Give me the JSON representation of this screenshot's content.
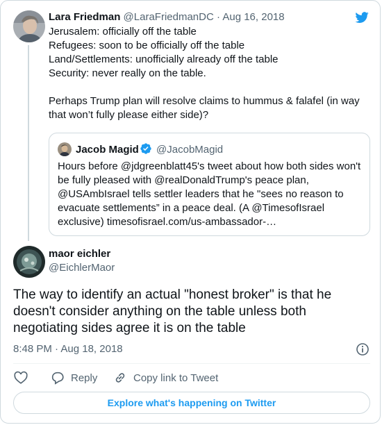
{
  "brand": {
    "icon": "twitter-bird-icon",
    "color": "#1d9bf0"
  },
  "parent_tweet": {
    "author_name": "Lara Friedman",
    "author_handle": "@LaraFriedmanDC",
    "separator": "·",
    "date": "Aug 16, 2018",
    "lines": [
      "Jerusalem: officially off the table",
      "Refugees: soon to be officially off the table",
      "Land/Settlements: unofficially already off the table",
      "Security: never really on the table."
    ],
    "paragraph2": "Perhaps Trump plan will resolve claims to hummus & falafel (in way that won’t fully please either side)?"
  },
  "quoted_tweet": {
    "author_name": "Jacob Magid",
    "verified": true,
    "author_handle": "@JacobMagid",
    "text": "Hours before @jdgreenblatt45's tweet about how both sides won't be fully pleased with @realDonaldTrump's peace plan, @USAmbIsrael tells settler leaders that he \"sees no reason to evacuate settlements” in a peace deal. (A @TimesofIsrael exclusive) timesofisrael.com/us-ambassador-…"
  },
  "main_tweet": {
    "author_name": "maor eichler",
    "author_handle": "@EichlerMaor",
    "text": "The way to identify an actual \"honest broker\" is that he doesn't consider anything on the table unless both negotiating sides agree it is on the table",
    "time": "8:48 PM",
    "separator": "·",
    "date": "Aug 18, 2018"
  },
  "actions": {
    "like_icon": "heart-icon",
    "reply_label": "Reply",
    "copy_link_label": "Copy link to Tweet"
  },
  "explore_label": "Explore what's happening on Twitter"
}
